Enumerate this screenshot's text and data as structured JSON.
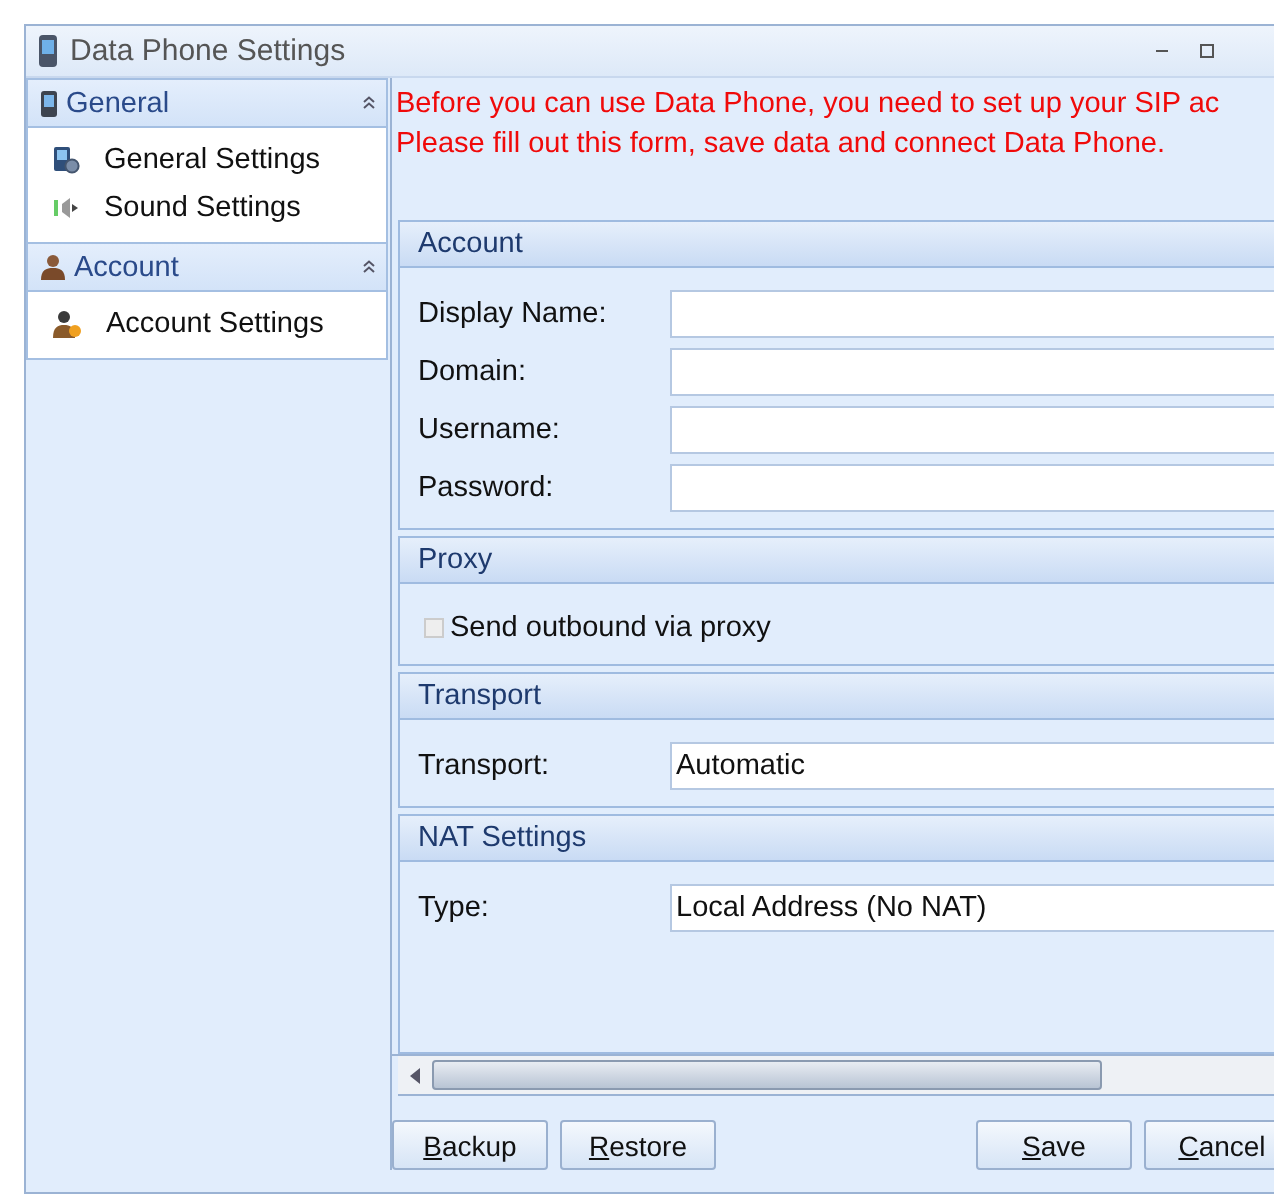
{
  "window": {
    "title": "Data Phone Settings"
  },
  "sidebar": {
    "groups": [
      {
        "title": "General",
        "expanded": true,
        "items": [
          {
            "label": "General Settings"
          },
          {
            "label": "Sound Settings"
          }
        ]
      },
      {
        "title": "Account",
        "expanded": true,
        "items": [
          {
            "label": "Account Settings"
          }
        ]
      }
    ]
  },
  "notice": [
    "Before you can use Data Phone, you need to set up your SIP ac",
    "Please fill out this form, save data and connect Data Phone."
  ],
  "sections": [
    {
      "title": "Account",
      "kind": "fields",
      "fields": [
        {
          "label": "Display Name:"
        },
        {
          "label": "Domain:"
        },
        {
          "label": "Username:"
        },
        {
          "label": "Password:"
        }
      ]
    },
    {
      "title": "Proxy",
      "kind": "checkbox",
      "checkbox": {
        "label": "Send outbound via proxy",
        "checked": false,
        "disabled": true
      }
    },
    {
      "title": "Transport",
      "kind": "fields",
      "fields": [
        {
          "label": "Transport:",
          "value": "Automatic"
        }
      ]
    },
    {
      "title": "NAT Settings",
      "kind": "fields",
      "fields": [
        {
          "label": "Type:",
          "value": "Local Address (No NAT)"
        }
      ]
    }
  ],
  "buttons_left": [
    "Backup",
    "Restore"
  ],
  "buttons_right": [
    "Save",
    "Cancel"
  ]
}
